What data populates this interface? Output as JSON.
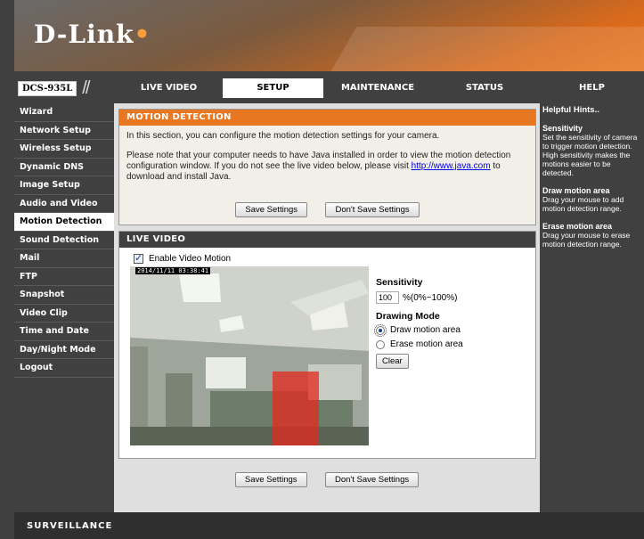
{
  "brand": {
    "logo_text": "D-Link",
    "logo_dot": "•",
    "model": "DCS-935L",
    "slashes": "//"
  },
  "nav": {
    "tabs": [
      "LIVE VIDEO",
      "SETUP",
      "MAINTENANCE",
      "STATUS",
      "HELP"
    ],
    "active": "SETUP"
  },
  "sidebar": {
    "items": [
      "Wizard",
      "Network Setup",
      "Wireless Setup",
      "Dynamic DNS",
      "Image Setup",
      "Audio and Video",
      "Motion Detection",
      "Sound Detection",
      "Mail",
      "FTP",
      "Snapshot",
      "Video Clip",
      "Time and Date",
      "Day/Night Mode",
      "Logout"
    ],
    "active": "Motion Detection"
  },
  "motion_panel": {
    "title": "MOTION DETECTION",
    "intro": "In this section, you can configure the motion detection settings for your camera.",
    "java_note_1": "Please note that your computer needs to have Java installed in order to view the motion detection configuration window. If you do not see the live video below, please visit ",
    "java_link": "http://www.java.com",
    "java_note_2": " to download and install Java.",
    "save": "Save Settings",
    "dont_save": "Don't Save Settings"
  },
  "live_panel": {
    "title": "LIVE VIDEO",
    "enable_label": "Enable Video Motion",
    "enable_checked": true,
    "timestamp": "2014/11/11 03:38:41",
    "sensitivity_label": "Sensitivity",
    "sensitivity_value": "100",
    "sensitivity_range": "%(0%~100%)",
    "drawing_mode_label": "Drawing Mode",
    "draw_label": "Draw motion area",
    "erase_label": "Erase motion area",
    "drawing_mode_selected": "draw",
    "clear": "Clear"
  },
  "bottom": {
    "save": "Save Settings",
    "dont_save": "Don't Save Settings"
  },
  "help": {
    "title": "Helpful Hints..",
    "items": [
      {
        "h": "Sensitivity",
        "t": "Set the sensitivity of camera to trigger motion detection. High sensitivity makes the motions easier to be detected."
      },
      {
        "h": "Draw motion area",
        "t": "Drag your mouse to add motion detection range."
      },
      {
        "h": "Erase motion area",
        "t": "Drag your mouse to erase motion detection range."
      }
    ]
  },
  "footer": {
    "label": "SURVEILLANCE"
  },
  "colors": {
    "accent": "#e87722",
    "dark": "#404040",
    "motion_overlay": "#e6281e"
  }
}
